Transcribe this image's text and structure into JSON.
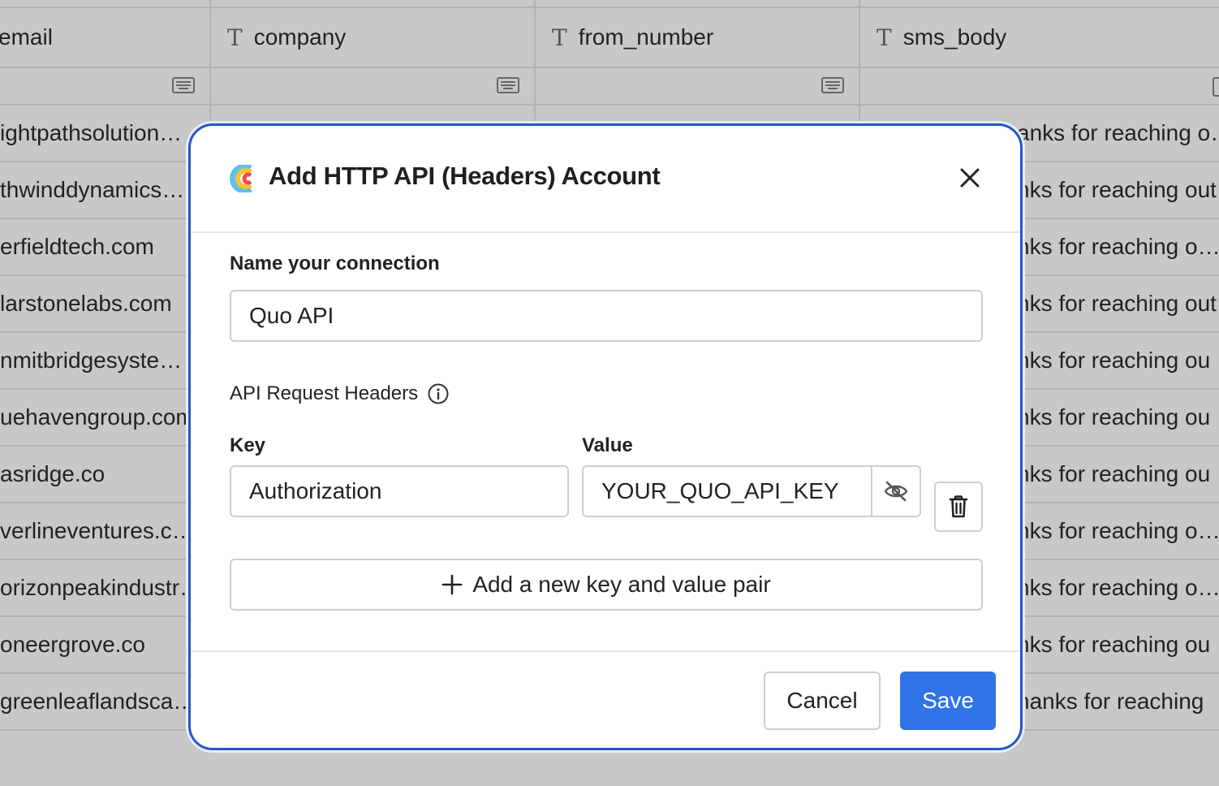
{
  "table": {
    "columns": [
      {
        "name": "email",
        "type_icon": "text-type-icon"
      },
      {
        "name": "company",
        "type_icon": "text-type-icon"
      },
      {
        "name": "from_number",
        "type_icon": "text-type-icon"
      },
      {
        "name": "sms_body",
        "type_icon": "text-type-icon"
      }
    ],
    "email_cells": [
      "ightpathsolution…",
      "thwinddynamics…",
      "erfieldtech.com",
      "larstonelabs.com",
      "nmitbridgesyste…",
      "uehavengroup.com",
      "asridge.co",
      "verlineventures.c…",
      "orizonpeakindustr…",
      "oneergrove.co",
      "greenleaflandsca…"
    ],
    "sms_cells": [
      "anks for reaching o…",
      "nks for reaching out",
      "nks for reaching o…",
      "nks for reaching out",
      "nks for reaching ou",
      "nks for reaching ou",
      "nks for reaching ou",
      "nks for reaching o…",
      "nks for reaching o…",
      "nks for reaching ou",
      "hanks for reaching"
    ]
  },
  "modal": {
    "title": "Add HTTP API (Headers) Account",
    "connection_label": "Name your connection",
    "connection_value": "Quo API",
    "headers_label": "API Request Headers",
    "key_label": "Key",
    "value_label": "Value",
    "key_value": "Authorization",
    "value_value": "YOUR_QUO_API_KEY",
    "add_pair_label": "Add a new key and value pair",
    "cancel_label": "Cancel",
    "save_label": "Save"
  },
  "colors": {
    "backdrop": "#c8c8c8",
    "modal_border": "#2757c7",
    "primary": "#2f73e6"
  }
}
